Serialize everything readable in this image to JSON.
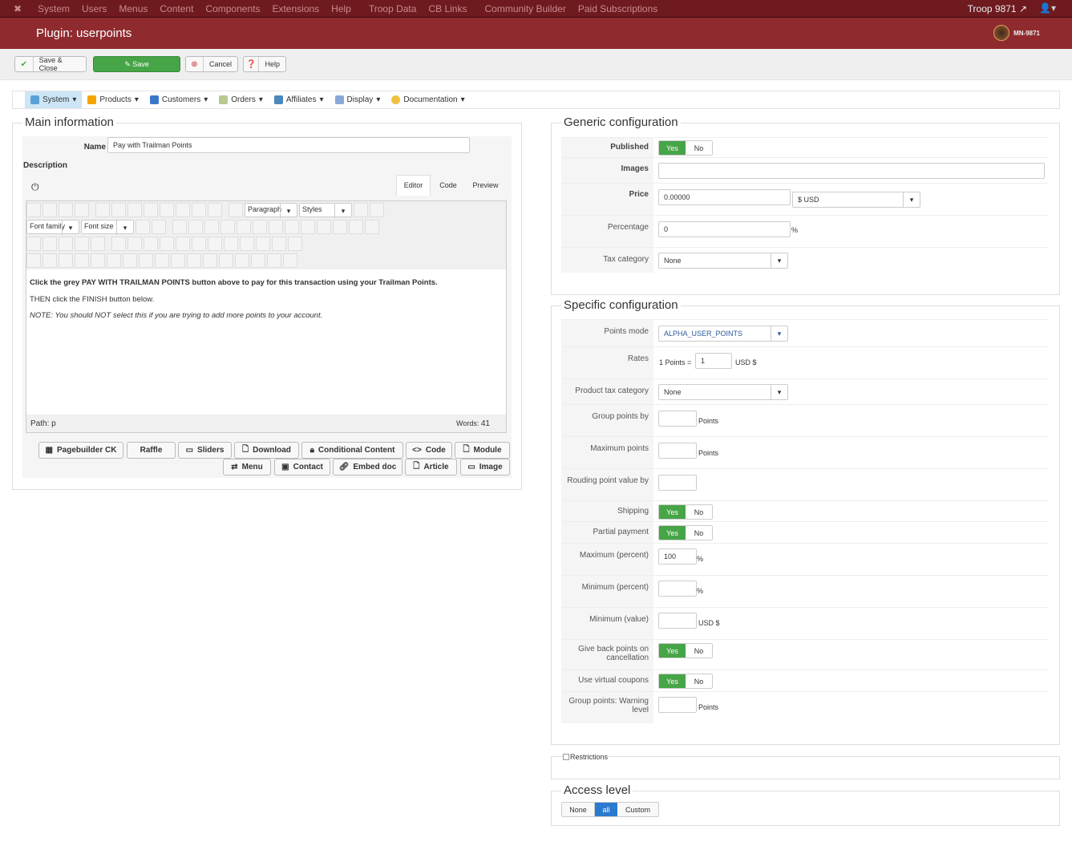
{
  "topbar": {
    "menu": [
      "System",
      "Users",
      "Menus",
      "Content",
      "Components",
      "Extensions",
      "Help",
      "Troop Data",
      "CB Links",
      "Community Builder",
      "Paid Subscriptions"
    ],
    "site": "Troop 9871"
  },
  "header": {
    "title": "Plugin: userpoints",
    "brand": "MN-9871"
  },
  "toolbar": {
    "save_close": "Save & Close",
    "save": "Save",
    "cancel": "Cancel",
    "help": "Help"
  },
  "menu": [
    "System",
    "Products",
    "Customers",
    "Orders",
    "Affiliates",
    "Display",
    "Documentation"
  ],
  "main": {
    "legend": "Main information",
    "name_label": "Name",
    "name_value": "Pay with Trailman Points",
    "description_label": "Description",
    "tabs": [
      "Editor",
      "Code",
      "Preview"
    ],
    "format": "Paragraph",
    "styles": "Styles",
    "font_family": "Font family",
    "font_size": "Font size",
    "content": [
      "Click the grey PAY WITH TRAILMAN POINTS button above to pay for this transaction using your Trailman Points.",
      "THEN click the FINISH button below.",
      "NOTE: You should NOT select this if you are trying to add more points to your account."
    ],
    "path_label": "Path:",
    "path_value": "p",
    "words_label": "Words:",
    "words_value": "41",
    "buttons": [
      "Pagebuilder CK",
      "Raffle",
      "Sliders",
      "Download",
      "Conditional Content",
      "Code",
      "Module",
      "Menu",
      "Contact",
      "Embed doc",
      "Article",
      "Image"
    ]
  },
  "generic": {
    "legend": "Generic configuration",
    "published": "Published",
    "images": "Images",
    "price": "Price",
    "price_value": "0.00000",
    "currency": "$ USD",
    "percentage": "Percentage",
    "percentage_value": "0",
    "percent_sign": "%",
    "tax_category": "Tax category",
    "tax_value": "None",
    "yes": "Yes",
    "no": "No"
  },
  "specific": {
    "legend": "Specific configuration",
    "points_mode": "Points mode",
    "points_mode_value": "ALPHA_USER_POINTS",
    "rates": "Rates",
    "rates_prefix": "1 Points =",
    "rates_value": "1",
    "rates_suffix": "USD $",
    "product_tax": "Product tax category",
    "product_tax_value": "None",
    "group_points": "Group points by",
    "points": "Points",
    "max_points": "Maximum points",
    "rounding": "Rouding point value by",
    "shipping": "Shipping",
    "partial": "Partial payment",
    "max_percent": "Maximum (percent)",
    "max_percent_value": "100",
    "pct": "%",
    "min_percent": "Minimum (percent)",
    "min_value": "Minimum (value)",
    "usd": "USD $",
    "give_back": "Give back points on cancellation",
    "virtual_coupons": "Use virtual coupons",
    "warning_level": "Group points: Warning level"
  },
  "restrictions": "Restrictions",
  "access": {
    "legend": "Access level",
    "options": [
      "None",
      "all",
      "Custom"
    ],
    "selected": "all"
  }
}
